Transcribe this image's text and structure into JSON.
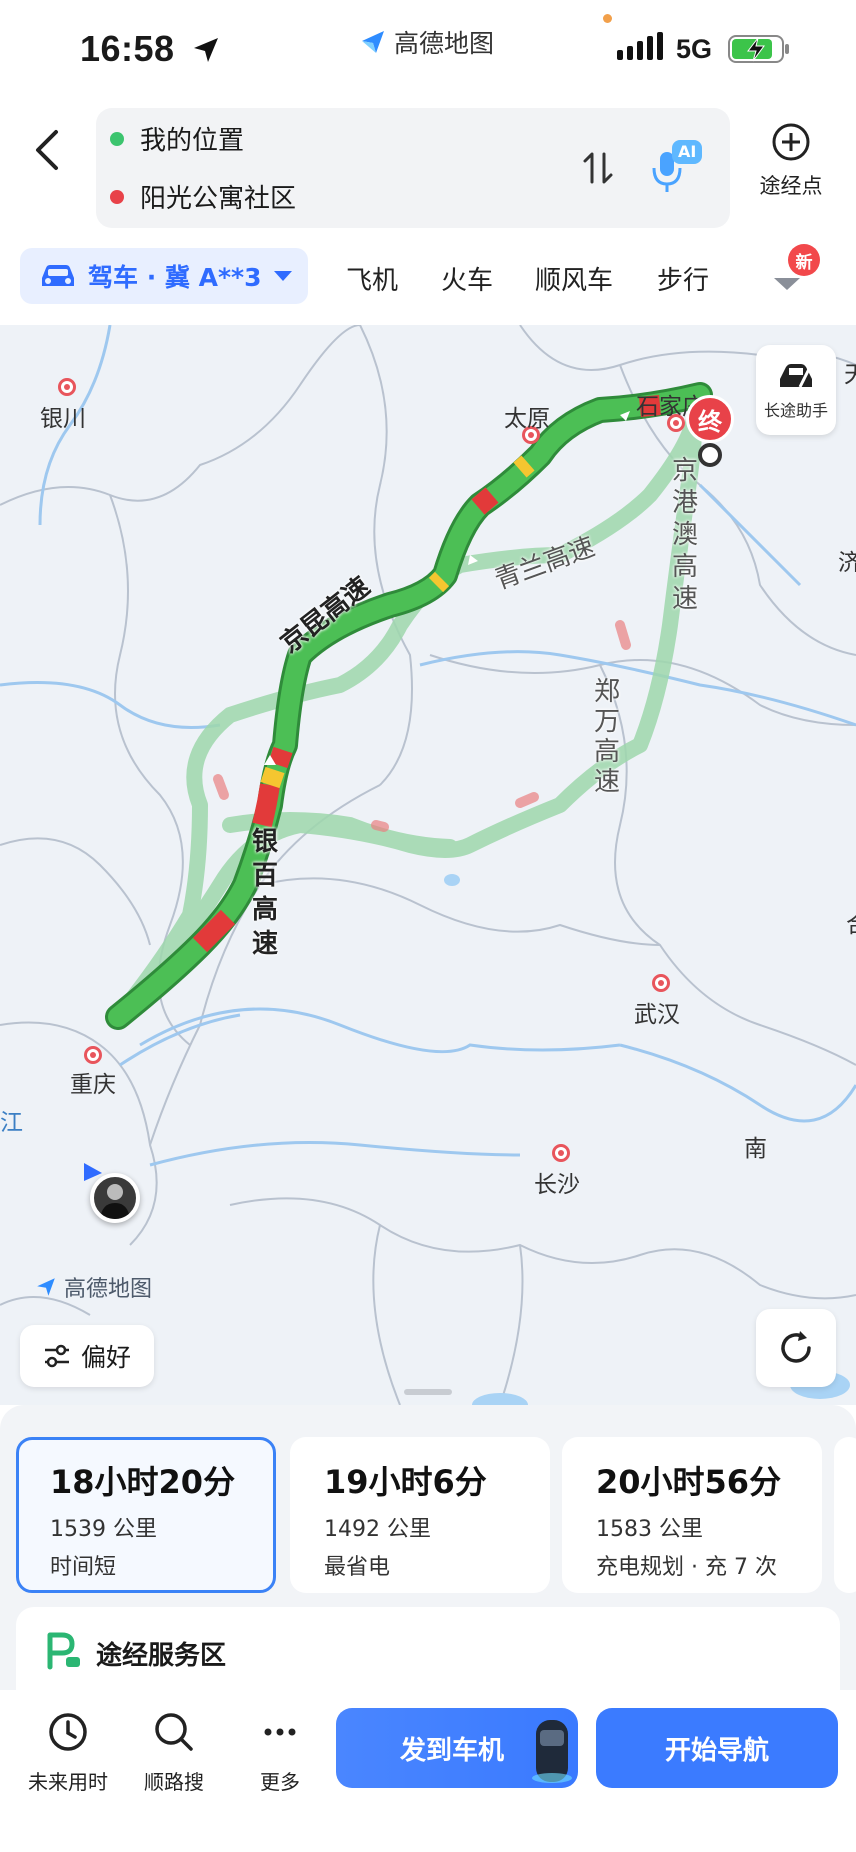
{
  "status_bar": {
    "time": "16:58",
    "brand": "高德地图",
    "network": "5G",
    "icons": [
      "location-arrow-icon",
      "signal-icon",
      "battery-charging-icon"
    ]
  },
  "header": {
    "origin": "我的位置",
    "destination": "阳光公寓社区",
    "waypoint_label": "途经点",
    "ai_badge": "AI",
    "origin_color": "#3cc46e",
    "destination_color": "#e84249"
  },
  "modes": {
    "car_label": "驾车 · 冀 A**3",
    "tabs": [
      "飞机",
      "火车",
      "顺风车",
      "步行"
    ],
    "new_badge": "新",
    "accent": "#2f6bff"
  },
  "map": {
    "cities": [
      {
        "name": "银川",
        "key": "yinchuan"
      },
      {
        "name": "太原",
        "key": "taiyuan"
      },
      {
        "name": "石家庄",
        "key": "shijiazhuang"
      },
      {
        "name": "武汉",
        "key": "wuhan"
      },
      {
        "name": "长沙",
        "key": "changsha"
      },
      {
        "name": "重庆",
        "key": "chongqing"
      }
    ],
    "highways": {
      "jingkun": "京昆高速",
      "qinglan": "青兰高速",
      "jinggangao": "京港澳高速",
      "zhengwan": "郑万高速",
      "yinbai": "银百高速"
    },
    "end_marker": "终",
    "assistant_label": "长途助手",
    "watermark": "高德地图",
    "preference_label": "偏好",
    "edge_labels": [
      "江",
      "南",
      "济",
      "天",
      "合"
    ],
    "route_color_main": "#43b34a",
    "route_color_alt": "#9fd8ad",
    "congestion_colors": [
      "#e23a3a",
      "#f5c630"
    ]
  },
  "routes": [
    {
      "duration": "18小时20分",
      "distance": "1539 公里",
      "tag": "时间短",
      "selected": true
    },
    {
      "duration": "19小时6分",
      "distance": "1492 公里",
      "tag": "最省电",
      "selected": false
    },
    {
      "duration": "20小时56分",
      "distance": "1583 公里",
      "tag": "充电规划 · 充 7 次",
      "selected": false
    }
  ],
  "service_area": {
    "label": "途经服务区"
  },
  "bottom": {
    "future_time": "未来用时",
    "along_search": "顺路搜",
    "more": "更多",
    "send_to_car": "发到车机",
    "start_nav": "开始导航"
  }
}
